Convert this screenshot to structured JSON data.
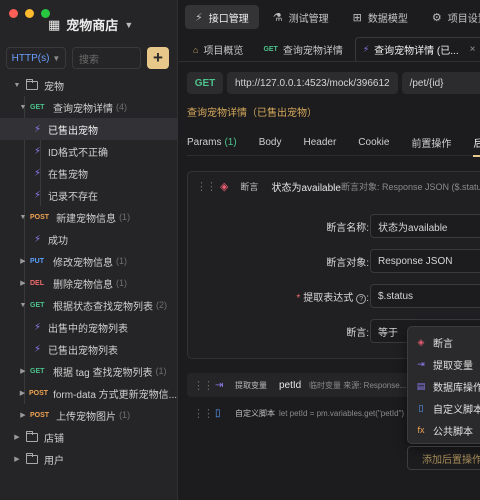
{
  "app": {
    "project_name": "宠物商店"
  },
  "sidebar": {
    "protocol": "HTTP(s)",
    "search_placeholder": "搜索",
    "add_label": "+",
    "tree": [
      {
        "kind": "folder",
        "label": "宠物",
        "expanded": true
      },
      {
        "kind": "endpoint",
        "method": "GET",
        "label": "查询宠物详情",
        "count": "(4)"
      },
      {
        "kind": "case",
        "label": "已售出宠物",
        "selected": true
      },
      {
        "kind": "case",
        "label": "ID格式不正确"
      },
      {
        "kind": "case",
        "label": "在售宠物"
      },
      {
        "kind": "case",
        "label": "记录不存在"
      },
      {
        "kind": "endpoint",
        "method": "POST",
        "label": "新建宠物信息",
        "count": "(1)"
      },
      {
        "kind": "case",
        "label": "成功"
      },
      {
        "kind": "endpoint",
        "method": "PUT",
        "label": "修改宠物信息",
        "count": "(1)"
      },
      {
        "kind": "endpoint",
        "method": "DEL",
        "label": "删除宠物信息",
        "count": "(1)"
      },
      {
        "kind": "endpoint",
        "method": "GET",
        "label": "根据状态查找宠物列表",
        "count": "(2)"
      },
      {
        "kind": "case",
        "label": "出售中的宠物列表"
      },
      {
        "kind": "case",
        "label": "已售出宠物列表"
      },
      {
        "kind": "endpoint",
        "method": "GET",
        "label": "根据 tag 查找宠物列表",
        "count": "(1)"
      },
      {
        "kind": "endpoint",
        "method": "POST",
        "label": "form-data 方式更新宠物信...",
        "count": ""
      },
      {
        "kind": "endpoint",
        "method": "POST",
        "label": "上传宠物图片",
        "count": "(1)"
      },
      {
        "kind": "folder",
        "label": "店铺",
        "expanded": false
      },
      {
        "kind": "folder",
        "label": "用户",
        "expanded": false
      }
    ]
  },
  "topnav": [
    {
      "label": "接口管理",
      "icon": "⚡",
      "active": true
    },
    {
      "label": "测试管理",
      "icon": "⚗",
      "active": false
    },
    {
      "label": "数据模型",
      "icon": "⊞",
      "active": false
    },
    {
      "label": "项目设置",
      "icon": "⚙",
      "active": false
    }
  ],
  "tabs": [
    {
      "label": "项目概览",
      "icon": "⌂",
      "method": "",
      "active": false
    },
    {
      "label": "查询宠物详情",
      "icon": "",
      "method": "GET",
      "active": false
    },
    {
      "label": "查询宠物详情 (已...",
      "icon": "⚡",
      "method": "",
      "active": true,
      "close": "×"
    }
  ],
  "request": {
    "method": "GET",
    "base_url": "http://127.0.0.1:4523/mock/396612",
    "path": "/pet/{id}"
  },
  "case_title": "查询宠物详情（已售出宠物）",
  "subtabs": [
    {
      "label": "Params",
      "count": "(1)",
      "active": false
    },
    {
      "label": "Body",
      "count": "",
      "active": false
    },
    {
      "label": "Header",
      "count": "",
      "active": false
    },
    {
      "label": "Cookie",
      "count": "",
      "active": false
    },
    {
      "label": "前置操作",
      "count": "",
      "active": false
    },
    {
      "label": "后置",
      "count": "",
      "active": true
    }
  ],
  "assertion": {
    "type": "断言",
    "name": "状态为available",
    "desc": "断言对象: Response JSON ($.status)",
    "fields": {
      "name_label": "断言名称:",
      "name_value": "状态为available",
      "target_label": "断言对象:",
      "target_value": "Response JSON",
      "expr_label": "提取表达式",
      "expr_value": "$.status",
      "assert_label": "断言:",
      "assert_value": "等于"
    }
  },
  "post_steps": [
    {
      "type": "提取变量",
      "name": "petId",
      "desc": "临时变量   来源: Response..."
    },
    {
      "type": "自定义脚本",
      "name": "",
      "desc": "let petId = pm.variables.get(\"petId\")"
    }
  ],
  "dropdown": [
    {
      "label": "断言",
      "icon": "◈",
      "color": "#e55b6f"
    },
    {
      "label": "提取变量",
      "icon": "⇥",
      "color": "#8c7cf0"
    },
    {
      "label": "数据库操作",
      "icon": "▤",
      "color": "#8c7cf0"
    },
    {
      "label": "自定义脚本",
      "icon": "▯",
      "color": "#5aa0ff"
    },
    {
      "label": "公共脚本",
      "icon": "fx",
      "color": "#f0a352"
    }
  ],
  "add_post_button": "添加后置操作"
}
